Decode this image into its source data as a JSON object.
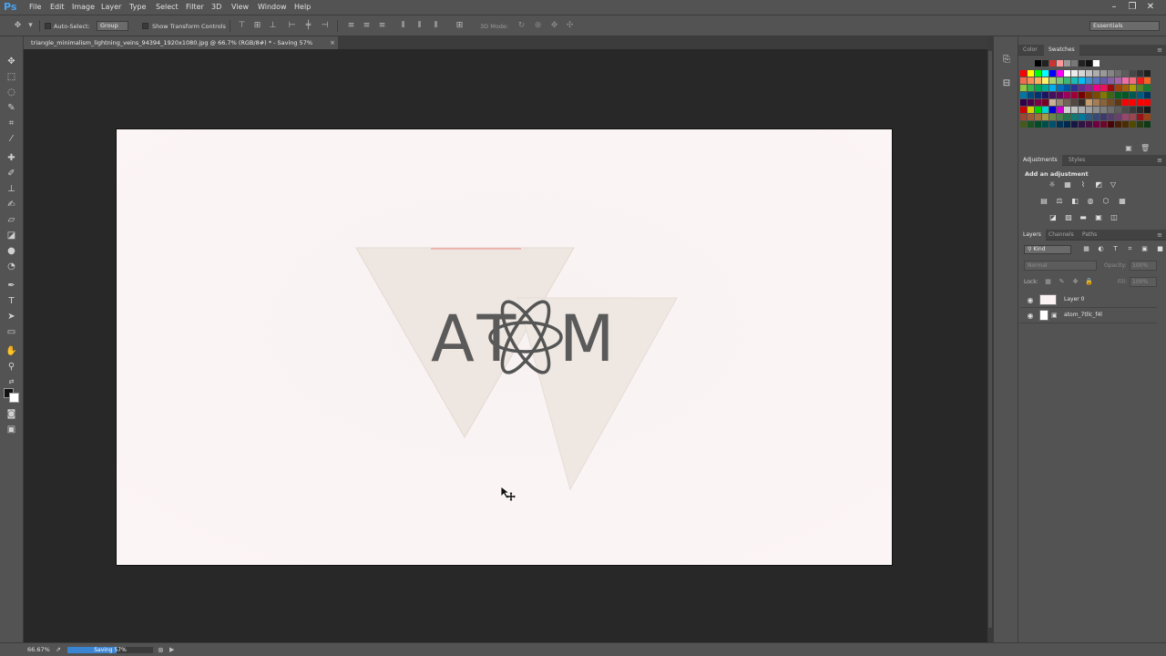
{
  "app": {
    "logo": "Ps"
  },
  "menubar": {
    "items": [
      "File",
      "Edit",
      "Image",
      "Layer",
      "Type",
      "Select",
      "Filter",
      "3D",
      "View",
      "Window",
      "Help"
    ],
    "window_controls": {
      "minimize_icon": "minimize-icon",
      "restore_icon": "restore-icon",
      "close_icon": "close-icon"
    }
  },
  "options": {
    "auto_select_label": "Auto-Select:",
    "auto_select_target": "Group",
    "show_transform_label": "Show Transform Controls",
    "mode_3d_label": "3D Mode:",
    "workspace": "Essentials"
  },
  "document": {
    "tab_title": "triangle_minimalism_lightning_veins_94394_1920x1080.jpg @ 66.7% (RGB/8#) * - Saving 57%",
    "close_glyph": "×",
    "canvas_background": "#fbf3f3",
    "logo_text_left": "AT",
    "logo_text_right": "M"
  },
  "panels": {
    "color_tabs": [
      "Color",
      "Swatches"
    ],
    "adjustments_tabs": [
      "Adjustments",
      "Styles"
    ],
    "adjustments_title": "Add an adjustment",
    "layers_tabs": [
      "Layers",
      "Channels",
      "Paths"
    ],
    "layers_filter": "Kind",
    "blend_mode": "Normal",
    "opacity_label": "Opacity:",
    "opacity_value": "100%",
    "lock_label": "Lock:",
    "fill_label": "Fill:",
    "fill_value": "100%",
    "layers": [
      {
        "name": "Layer 0"
      },
      {
        "name": "atom_7tllc_f4l"
      }
    ]
  },
  "status": {
    "zoom": "66.67%",
    "progress_label": "Saving 57%",
    "progress_value": 0.57
  }
}
